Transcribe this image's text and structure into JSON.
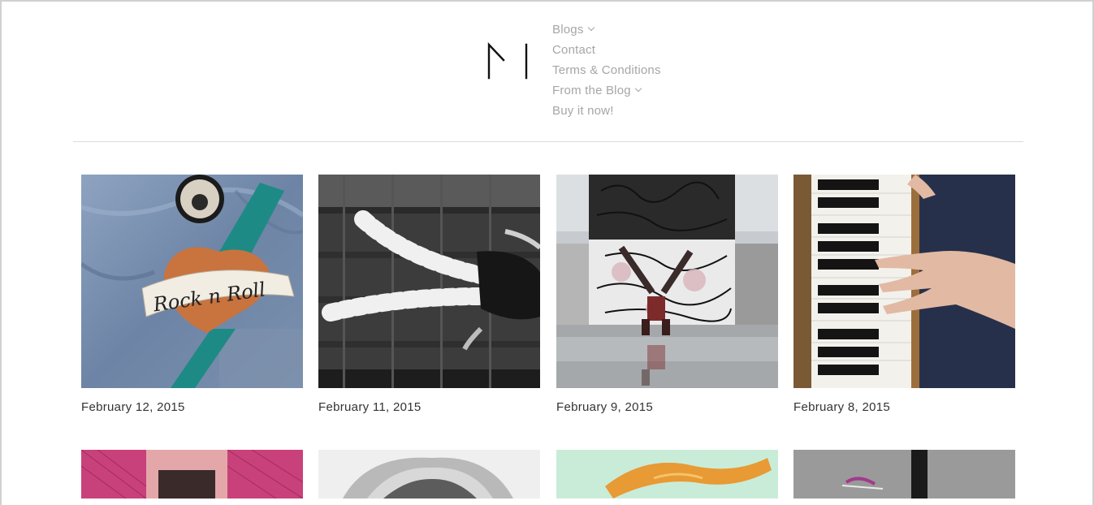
{
  "nav": {
    "items": [
      {
        "label": "Blogs",
        "has_dropdown": true
      },
      {
        "label": "Contact",
        "has_dropdown": false
      },
      {
        "label": "Terms & Conditions",
        "has_dropdown": false
      },
      {
        "label": "From the Blog",
        "has_dropdown": true
      },
      {
        "label": "Buy it now!",
        "has_dropdown": false
      }
    ]
  },
  "logo": {
    "icon": "m-monogram-logo"
  },
  "posts": [
    {
      "date": "February 12, 2015",
      "image": "rock-n-roll-denim-jacket-photo"
    },
    {
      "date": "February 11, 2015",
      "image": "striped-stockings-on-stairs-photo"
    },
    {
      "date": "February 9, 2015",
      "image": "breakdancer-graffiti-wall-photo"
    },
    {
      "date": "February 8, 2015",
      "image": "hands-on-piano-keys-photo"
    },
    {
      "date": "",
      "image": "pink-fishnet-photo"
    },
    {
      "date": "",
      "image": "blonde-portrait-photo"
    },
    {
      "date": "",
      "image": "orange-hair-photo"
    },
    {
      "date": "",
      "image": "street-pole-sneakers-photo"
    }
  ],
  "colors": {
    "nav_text": "#a6a6a6",
    "date_text": "#333333",
    "divider": "#dcdcdc"
  }
}
